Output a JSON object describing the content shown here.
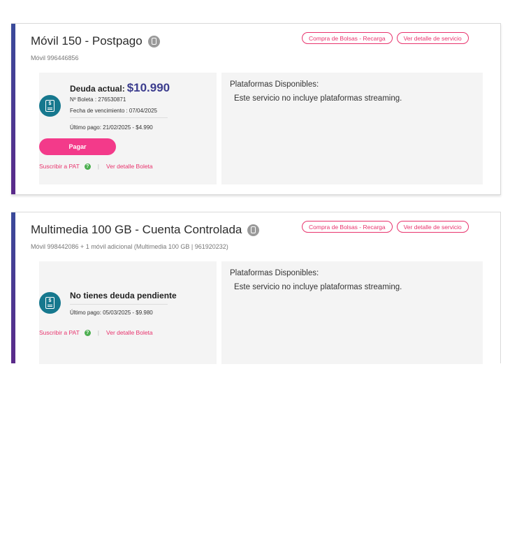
{
  "services": [
    {
      "title": "Móvil 150 - Postpago",
      "subtitle": "Móvil 996446856",
      "actions": [
        "Compra de Bolsas - Recarga",
        "Ver detalle de servicio"
      ],
      "debt_label": "Deuda actual:",
      "debt_amount": "$10.990",
      "boleta": "Nº Boleta : 276530871",
      "due_date": "Fecha de vencimiento : 07/04/2025",
      "last_payment": "Último pago: 21/02/2025 - $4.990",
      "pay_button": "Pagar",
      "subscribe_pat": "Suscribir a PAT",
      "help": "?",
      "bill_detail": "Ver detalle Boleta",
      "platforms_title": "Plataformas Disponibles:",
      "platforms_text": "Este servicio no incluye plataformas streaming."
    },
    {
      "title": "Multimedia 100 GB - Cuenta Controlada",
      "subtitle": "Móvil 998442086 + 1 móvil adicional (Multimedia 100 GB | 961920232)",
      "actions": [
        "Compra de Bolsas - Recarga",
        "Ver detalle de servicio"
      ],
      "no_debt": "No tienes deuda pendiente",
      "last_payment": "Último pago: 05/03/2025 - $9.980",
      "subscribe_pat": "Suscribir a PAT",
      "help": "?",
      "bill_detail": "Ver detalle Boleta",
      "platforms_title": "Plataformas Disponibles:",
      "platforms_text": "Este servicio no incluye plataformas streaming."
    }
  ],
  "icons": {
    "phone": "phone-icon",
    "bill": "bill-document-icon",
    "help": "help-icon"
  },
  "colors": {
    "accent": "#e8336d",
    "pay_button": "#f33a8a",
    "debt_amount": "#3c3d8e",
    "bill_icon": "#16788e",
    "card_stripe": "#3a4a9a"
  }
}
